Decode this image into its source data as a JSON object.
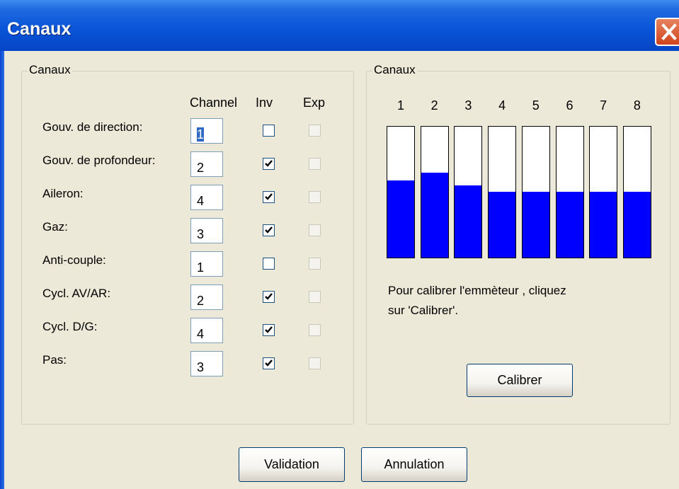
{
  "window": {
    "title": "Canaux"
  },
  "left_group": {
    "legend": "Canaux",
    "headers": {
      "channel": "Channel",
      "inv": "Inv",
      "exp": "Exp"
    },
    "rows": [
      {
        "label": "Gouv. de direction:",
        "channel": "1",
        "inv": false,
        "exp": false,
        "focused": true
      },
      {
        "label": "Gouv. de profondeur:",
        "channel": "2",
        "inv": true,
        "exp": false
      },
      {
        "label": "Aileron:",
        "channel": "4",
        "inv": true,
        "exp": false
      },
      {
        "label": "Gaz:",
        "channel": "3",
        "inv": true,
        "exp": false
      },
      {
        "label": "Anti-couple:",
        "channel": "1",
        "inv": false,
        "exp": false
      },
      {
        "label": "Cycl. AV/AR:",
        "channel": "2",
        "inv": true,
        "exp": false
      },
      {
        "label": "Cycl. D/G:",
        "channel": "4",
        "inv": true,
        "exp": false
      },
      {
        "label": "Pas:",
        "channel": "3",
        "inv": true,
        "exp": false
      }
    ]
  },
  "right_group": {
    "legend": "Canaux",
    "channels": [
      {
        "label": "1",
        "level": 0.59
      },
      {
        "label": "2",
        "level": 0.65
      },
      {
        "label": "3",
        "level": 0.55
      },
      {
        "label": "4",
        "level": 0.5
      },
      {
        "label": "5",
        "level": 0.5
      },
      {
        "label": "6",
        "level": 0.5
      },
      {
        "label": "7",
        "level": 0.5
      },
      {
        "label": "8",
        "level": 0.5
      }
    ],
    "note_line1": "Pour calibrer l'emmèteur , cliquez",
    "note_line2": "sur 'Calibrer'.",
    "calibrate_label": "Calibrer",
    "bar_fill_color": "#0000ff"
  },
  "footer": {
    "validate_label": "Validation",
    "cancel_label": "Annulation"
  }
}
